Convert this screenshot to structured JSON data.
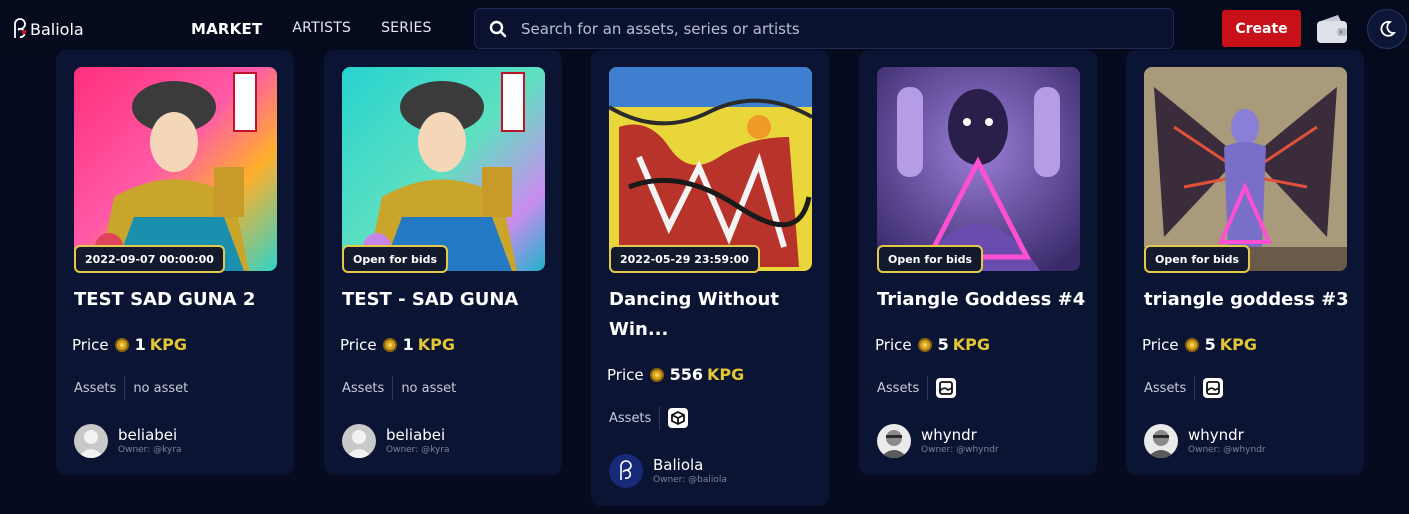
{
  "header": {
    "logo_text": "Baliola",
    "nav": [
      {
        "label": "MARKET",
        "active": true
      },
      {
        "label": "ARTISTS",
        "active": false
      },
      {
        "label": "SERIES",
        "active": false
      }
    ],
    "search_placeholder": "Search for an assets, series or artists",
    "create_label": "Create",
    "icons": [
      "baliola-logo-icon",
      "search-icon",
      "wallet-icon",
      "moon-icon"
    ]
  },
  "colors": {
    "background": "#060b1f",
    "card": "#0c1433",
    "accent_red": "#c8101a",
    "currency_yellow": "#e3c634",
    "badge_border": "#e2c94a"
  },
  "cards": [
    {
      "badge": "2022-09-07 00:00:00",
      "title": "TEST SAD GUNA 2",
      "price_label": "Price",
      "price_value": "1",
      "currency": "KPG",
      "assets_label": "Assets",
      "assets_value": "no asset",
      "owner_name": "beliabei",
      "owner_handle": "Owner: @kyra"
    },
    {
      "badge": "Open for bids",
      "title": "TEST - SAD GUNA",
      "price_label": "Price",
      "price_value": "1",
      "currency": "KPG",
      "assets_label": "Assets",
      "assets_value": "no asset",
      "owner_name": "beliabei",
      "owner_handle": "Owner: @kyra"
    },
    {
      "badge": "2022-05-29 23:59:00",
      "title_line1": "Dancing Without",
      "title_line2": "Win...",
      "price_label": "Price",
      "price_value": "556",
      "currency": "KPG",
      "assets_label": "Assets",
      "assets_icon": "cube-icon",
      "owner_name": "Baliola",
      "owner_handle": "Owner: @baliola"
    },
    {
      "badge": "Open for bids",
      "title": "Triangle Goddess #4",
      "price_label": "Price",
      "price_value": "5",
      "currency": "KPG",
      "assets_label": "Assets",
      "assets_icon": "image-icon",
      "owner_name": "whyndr",
      "owner_handle": "Owner: @whyndr"
    },
    {
      "badge": "Open for bids",
      "title": "triangle goddess #3",
      "price_label": "Price",
      "price_value": "5",
      "currency": "KPG",
      "assets_label": "Assets",
      "assets_icon": "image-icon",
      "owner_name": "whyndr",
      "owner_handle": "Owner: @whyndr"
    }
  ]
}
